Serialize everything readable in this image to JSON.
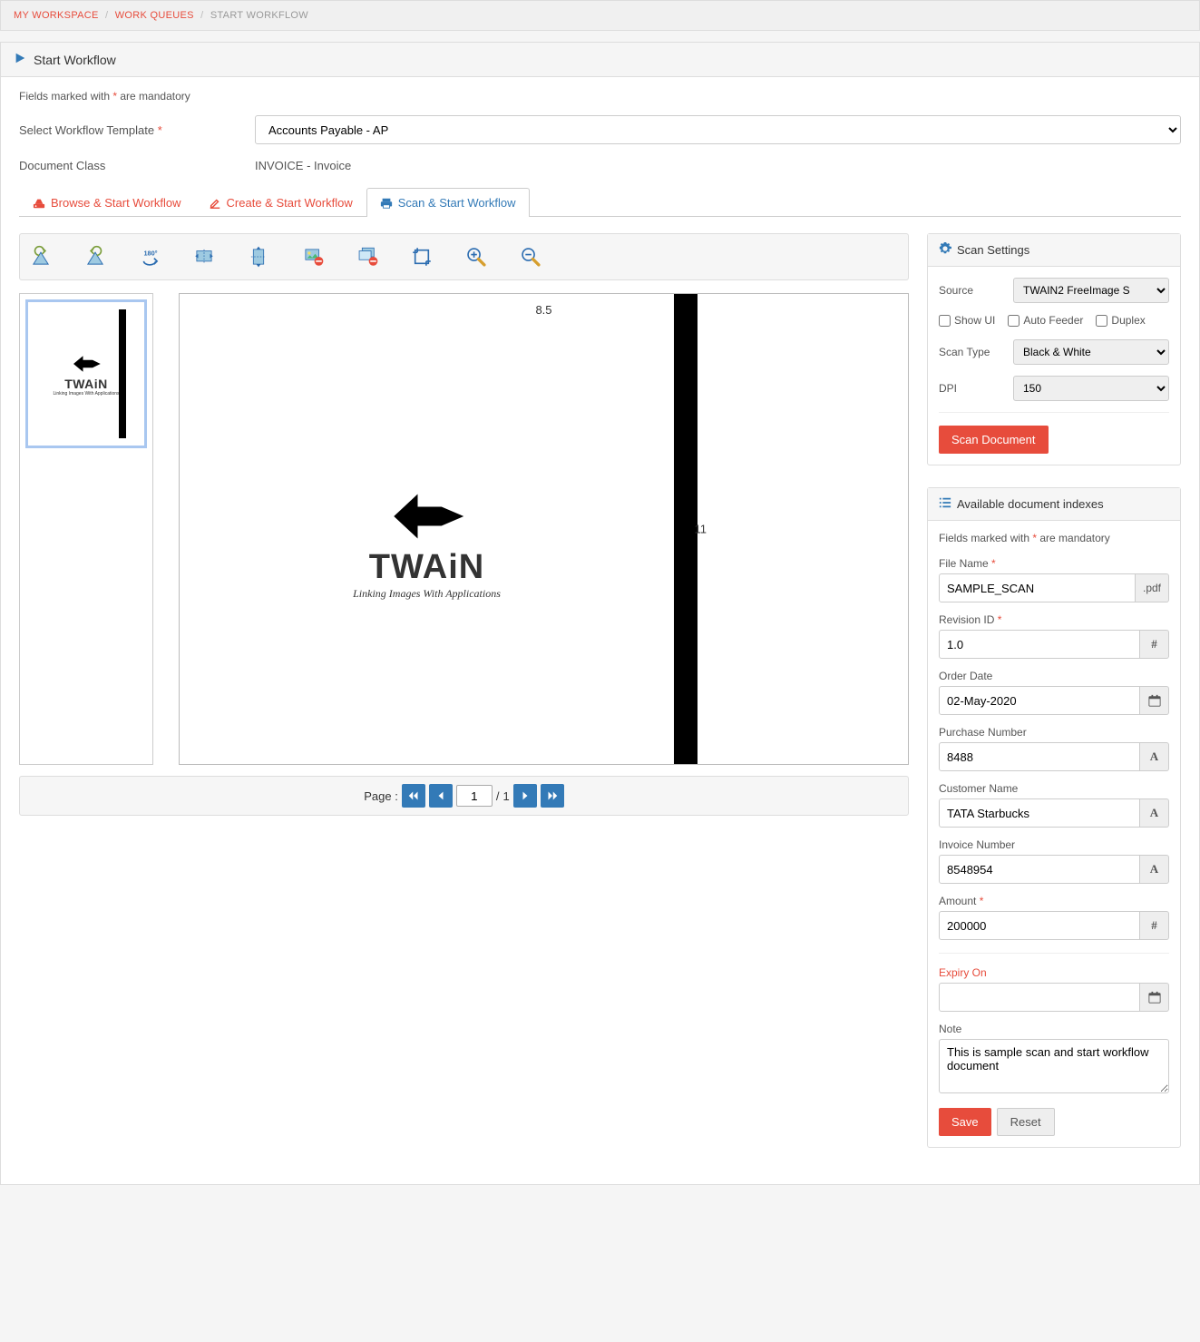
{
  "breadcrumb": {
    "a": "MY WORKSPACE",
    "b": "WORK QUEUES",
    "c": "START WORKFLOW"
  },
  "page_title": "Start Workflow",
  "mandatory_hint_pre": "Fields marked with ",
  "mandatory_hint_post": " are mandatory",
  "mandatory_star": "*",
  "form": {
    "template_label": "Select Workflow Template ",
    "template_value": "Accounts Payable - AP",
    "class_label": "Document Class",
    "class_value": "INVOICE - Invoice"
  },
  "tabs": {
    "browse": "Browse & Start Workflow",
    "create": "Create & Start Workflow",
    "scan": "Scan & Start Workflow"
  },
  "preview": {
    "width_label": "8.5",
    "height_label": "11",
    "twain_title": "TWAiN",
    "twain_tag": "Linking Images With Applications"
  },
  "pager": {
    "label": "Page :",
    "current": "1",
    "total": "1"
  },
  "scan_settings": {
    "title": "Scan Settings",
    "source_label": "Source",
    "source_value": "TWAIN2 FreeImage S",
    "show_ui": "Show UI",
    "auto_feeder": "Auto Feeder",
    "duplex": "Duplex",
    "scantype_label": "Scan Type",
    "scantype_value": "Black & White",
    "dpi_label": "DPI",
    "dpi_value": "150",
    "button": "Scan Document"
  },
  "indexes": {
    "title": "Available document indexes",
    "hint_pre": "Fields marked with ",
    "hint_post": " are mandatory",
    "filename_label": "File Name ",
    "filename_value": "SAMPLE_SCAN",
    "filename_ext": ".pdf",
    "revision_label": "Revision ID ",
    "revision_value": "1.0",
    "orderdate_label": "Order Date",
    "orderdate_value": "02-May-2020",
    "pon_label": "Purchase Number",
    "pon_value": "8488",
    "cust_label": "Customer Name",
    "cust_value": "TATA Starbucks",
    "inv_label": "Invoice Number",
    "inv_value": "8548954",
    "amount_label": "Amount ",
    "amount_value": "200000",
    "expiry_label": "Expiry On",
    "expiry_value": "",
    "note_label": "Note",
    "note_value": "This is sample scan and start workflow document",
    "save": "Save",
    "reset": "Reset"
  }
}
